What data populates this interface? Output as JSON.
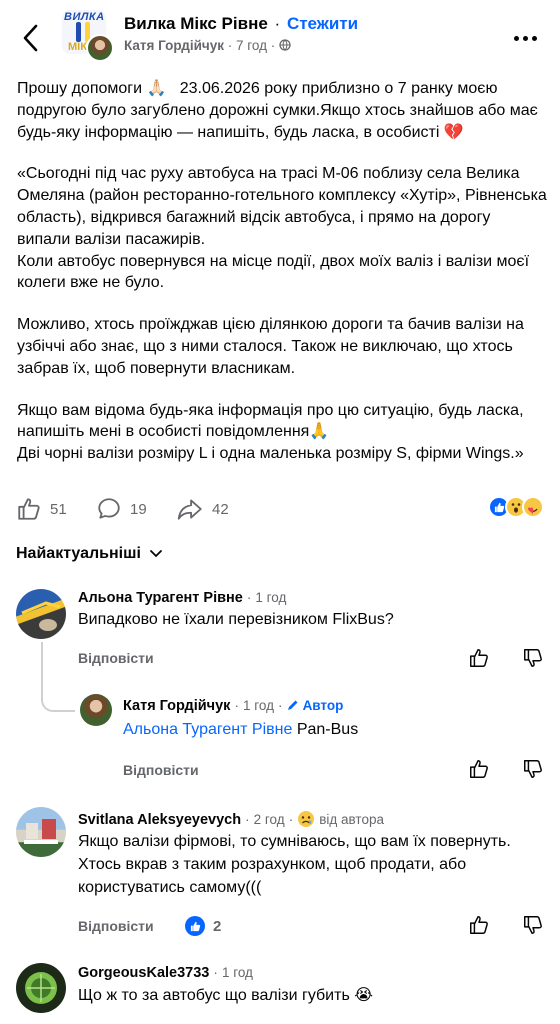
{
  "header": {
    "group_name": "Вилка Мікс Рівне",
    "separator": "·",
    "follow_label": "Стежити",
    "author": "Катя Гордійчук",
    "time": "7 год",
    "logo_text_top": "ВИЛКА",
    "logo_text_bottom": "МІКС"
  },
  "post": {
    "paragraphs": [
      "Прошу допомоги 🙏🏻   23.06.2026 року приблизно о 7 ранку моєю подругою було загублено дорожні сумки.Якщо хтось знайшов або має будь-яку інформацію — напишіть, будь ласка, в особисті 💔",
      "«Сьогодні під час руху автобуса на трасі М-06 поблизу села Велика Омеляна (район ресторанно-готельного комплексу «Хутір», Рівненська область), відкрився багажний відсік автобуса, і прямо на дорогу випали валізи пасажирів.\nКоли автобус повернувся на місце події, двох моїх валіз і валізи моєї колеги вже не було.",
      "Можливо, хтось проїжджав цією ділянкою дороги та бачив валізи на узбіччі або знає, що з ними сталося. Також не виключаю, що хтось забрав їх, щоб повернути власникам.",
      "Якщо вам відома будь-яка інформація про цю ситуацію, будь ласка, напишіть мені в особисті повідомлення🙏\nДві чорні валізи розміру L і одна маленька розміру S, фірми Wings.»"
    ]
  },
  "actions": {
    "likes": "51",
    "comments": "19",
    "shares": "42"
  },
  "sort": {
    "label": "Найактуальніші"
  },
  "comments": [
    {
      "name": "Альона Турагент Рівне",
      "time": "1 год",
      "text": "Випадково не їхали перевізником FlixBus?",
      "reply_label": "Відповісти"
    },
    {
      "name": "Катя Гордійчук",
      "time": "1 год",
      "badge": "Автор",
      "mention": "Альона Турагент Рівне",
      "text": " Pan-Bus",
      "reply_label": "Відповісти"
    },
    {
      "name": "Svitlana  Aleksyeyevych",
      "time": "2 год",
      "badge_text": "від автора",
      "text": "Якщо валізи фірмові, то сумніваюсь, що вам їх повернуть. Хтось вкрав з таким розрахунком, щоб продати, або користуватись самому(((",
      "reply_label": "Відповісти",
      "like_count": "2"
    },
    {
      "name": "GorgeousKale3733",
      "time": "1 год",
      "text": "Що ж то за автобус що валізи губить 😭"
    }
  ],
  "colors": {
    "accent": "#0866ff",
    "secondary_text": "#65676b"
  }
}
